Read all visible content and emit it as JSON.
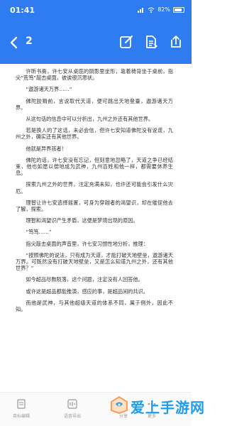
{
  "status_bar": {
    "time": "01:41",
    "battery": "82%"
  },
  "header": {
    "title": "2"
  },
  "content": {
    "paragraphs": [
      "许昕书斋，许七安从桌底的阴影里坐形，靠着椅背坐于桌前，指尖“荒笃”敲击桌面，彼诶很沉思状。",
      "“遨游诸天万界……”",
      "佛陀狡猾前，言说取代天道，便可跳出天地登臺，遨游诸天万界。",
      "从这句话的信息中可以分析出，九州之外还有其他世界。",
      "若是换人的了这话，未必会信，但许七安知道佛陀没有说谎，九州之外，确实还有其他世界。",
      "他就是异界孩者！",
      "佛陀的话，许七安没有忘记，但刻意地忽略了，天道之争已经结束，他也如愿以偿地成为武神，九州百姓和他一样，都需要休养生息。",
      "探索九州之外的世界，注定充满未知，也许还可能会引发什么灾厄。",
      "理智让许七安选择摇置，可身为穿越者的渴望识，却在催促他去了解，探索。",
      "理智和渴望识产生矛盾，这便是梦境出现的原因。",
      "“笃笃……”",
      "指尖敲击桌面的声音里，许七安习惯性地分析，推理：",
      "“按照佛陀的说法，只有成为天道，才能打破天地壁垒，遨游诸天万界。可既然没有打破天地壁垒，又是怎么知道九州之外，还有其他世界？”",
      "如今超品尽数陨落，这个问题，注定没有人回答他。",
      "或许这是超品都能推演，感应的事，是超品间的共识。",
      "而他是武神，与其他超级天道的体系不同，属于例外，因此不知。"
    ]
  },
  "bottom_tabs": [
    {
      "label": "目标编辑"
    },
    {
      "label": "语音导出"
    },
    {
      "label": "分享"
    },
    {
      "label": "更多"
    }
  ],
  "watermark": {
    "text": "爱上手游网"
  },
  "colors": {
    "header": "#2f7bf0",
    "watermark": "#1f9cf0"
  }
}
